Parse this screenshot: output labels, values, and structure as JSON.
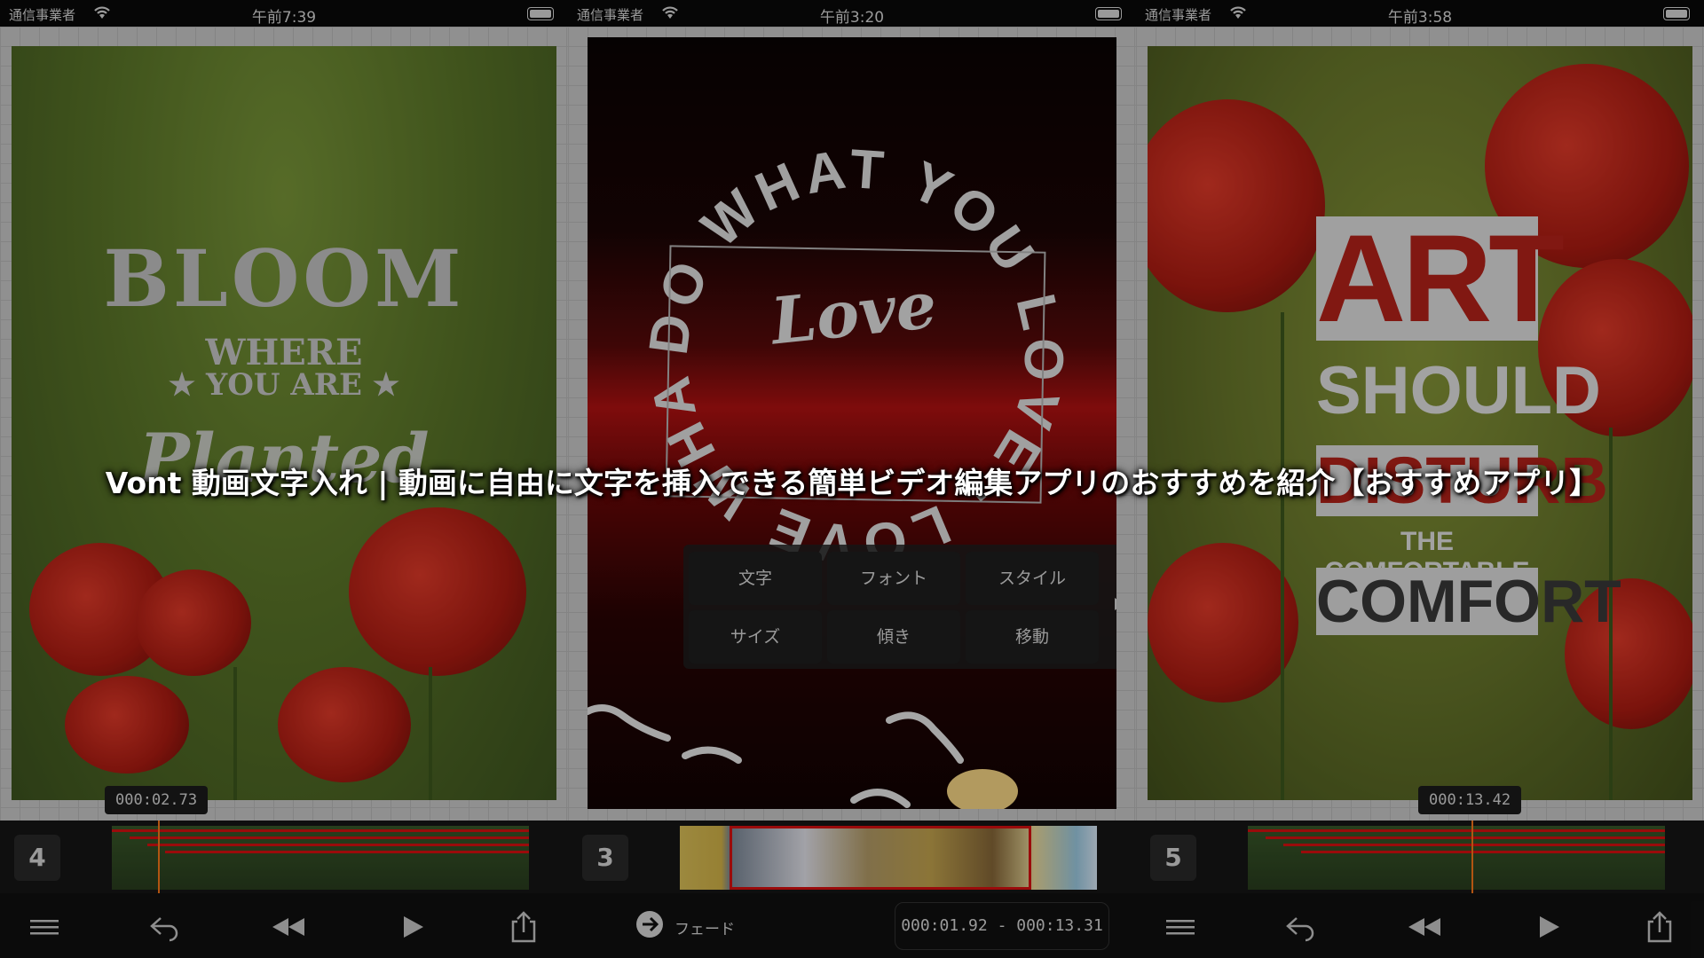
{
  "panels": [
    {
      "id": "p1",
      "carrier": "通信事業者",
      "time": "午前7:39",
      "text": {
        "line1": "BLOOM",
        "line2": "WHERE",
        "line3": "★ YOU ARE ★",
        "line4": "Planted"
      },
      "time_badge": "000:02.73",
      "track_number": "4"
    },
    {
      "id": "p2",
      "carrier": "通信事業者",
      "time": "午前3:20",
      "circle_text": "DO WHAT YOU LOVE · LOVE WHAT YOU DO",
      "center_word": "Love",
      "menu": [
        "文字",
        "フォント",
        "スタイル",
        "サイズ",
        "傾き",
        "移動"
      ],
      "track_number": "3",
      "fade_label": "フェード",
      "range": "000:01.92 - 000:13.31"
    },
    {
      "id": "p3",
      "carrier": "通信事業者",
      "time": "午前3:58",
      "text": {
        "line1": "ART",
        "line2": "SHOULD",
        "line3": "DISTURB",
        "line4": "THE COMFORTABLE &",
        "line5": "COMFORT"
      },
      "time_badge": "000:13.42",
      "track_number": "5"
    }
  ],
  "headline": "Vont 動画文字入れ | 動画に自由に文字を挿入できる簡単ビデオ編集アプリのおすすめを紹介【おすすめアプリ】",
  "colors": {
    "accent_red": "#d11111",
    "playhead": "#ff7a1a",
    "toolbar_bg": "#111111"
  },
  "icons": [
    "wifi-icon",
    "battery-icon",
    "menu-icon",
    "undo-icon",
    "rewind-icon",
    "play-icon",
    "share-icon",
    "fade-icon"
  ]
}
